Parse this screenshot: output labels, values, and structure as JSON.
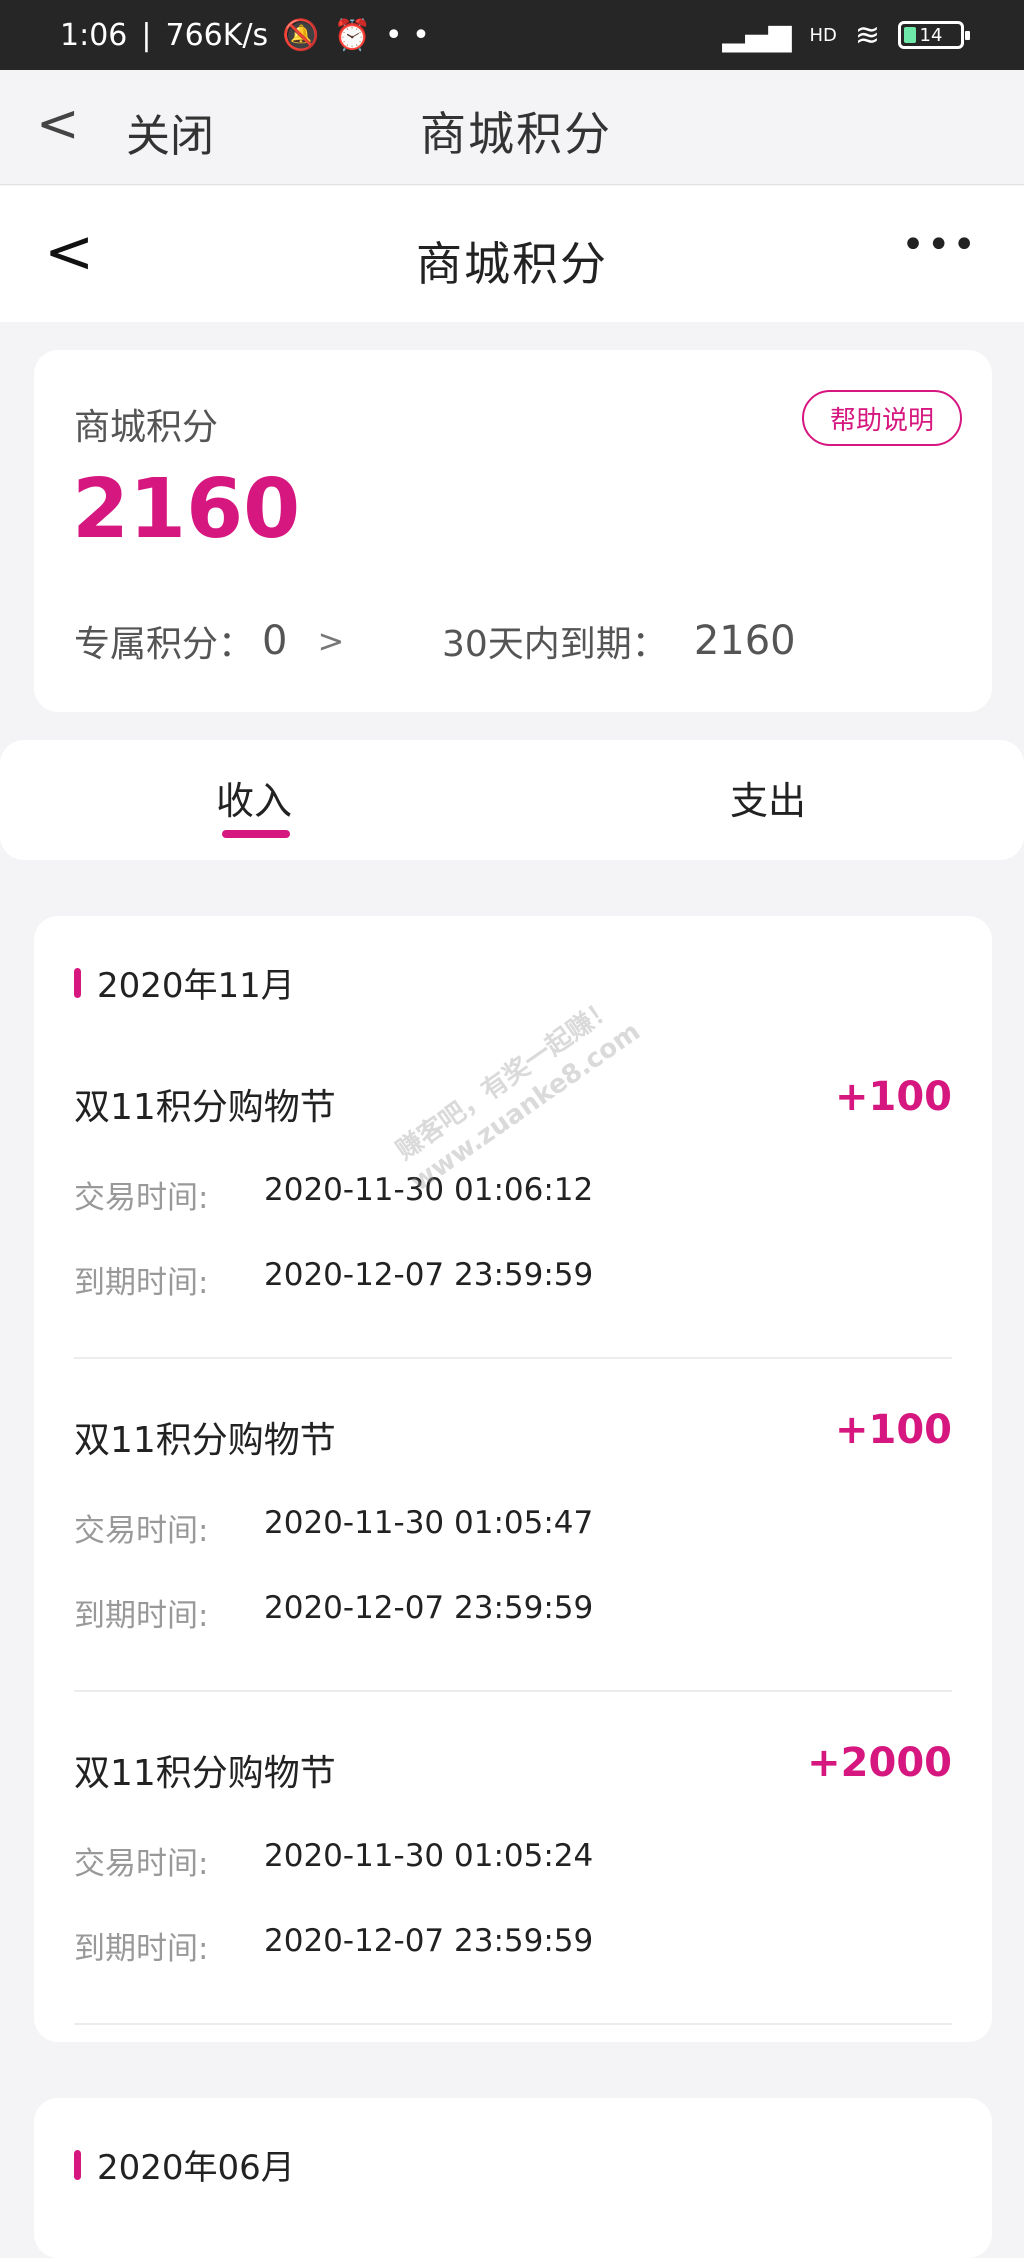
{
  "status": {
    "time": "1:06",
    "speed": "766K/s",
    "network": "HD",
    "battery": "14"
  },
  "nav1": {
    "back_label": "<",
    "close_label": "关闭",
    "title": "商城积分"
  },
  "nav2": {
    "back_label": "<",
    "title": "商城积分",
    "more_label": "•••"
  },
  "summary": {
    "label": "商城积分",
    "help_label": "帮助说明",
    "points": "2160",
    "exclusive_label": "专属积分：",
    "exclusive_value": "0",
    "exclusive_chevron": ">",
    "expiring_label": "30天内到期：",
    "expiring_value": "2160"
  },
  "tabs": [
    {
      "label": "收入"
    },
    {
      "label": "支出"
    }
  ],
  "months": [
    {
      "label": "2020年11月",
      "records": [
        {
          "name": "双11积分购物节",
          "amount": "+100",
          "trade_label": "交易时间:",
          "trade_time": "2020-11-30 01:06:12",
          "expire_label": "到期时间:",
          "expire_time": "2020-12-07 23:59:59"
        },
        {
          "name": "双11积分购物节",
          "amount": "+100",
          "trade_label": "交易时间:",
          "trade_time": "2020-11-30 01:05:47",
          "expire_label": "到期时间:",
          "expire_time": "2020-12-07 23:59:59"
        },
        {
          "name": "双11积分购物节",
          "amount": "+2000",
          "trade_label": "交易时间:",
          "trade_time": "2020-11-30 01:05:24",
          "expire_label": "到期时间:",
          "expire_time": "2020-12-07 23:59:59"
        }
      ]
    },
    {
      "label": "2020年06月",
      "records": []
    }
  ],
  "watermark": {
    "line1": "赚客吧，有奖一起赚！",
    "line2": "www.zuanke8.com"
  },
  "colors": {
    "accent": "#d6177f",
    "status_bar": "#262626",
    "background": "#f4f4f6"
  }
}
